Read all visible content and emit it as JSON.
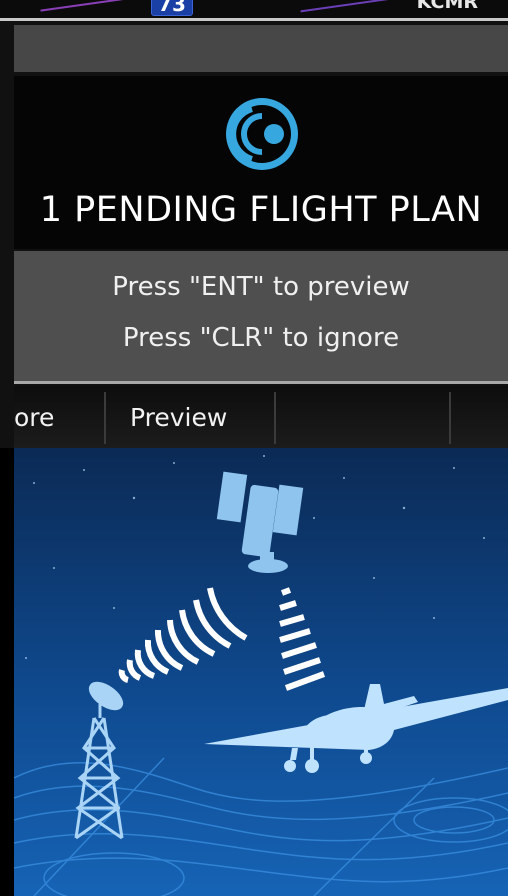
{
  "map_strip": {
    "badge": "73",
    "waypoint": "KCMR"
  },
  "alert": {
    "icon": "connext-signal-icon",
    "title": "1 PENDING FLIGHT PLAN",
    "line1": "Press \"ENT\" to preview",
    "line2": "Press \"CLR\" to ignore"
  },
  "softkeys": [
    {
      "label": "ore"
    },
    {
      "label": "Preview"
    },
    {
      "label": ""
    },
    {
      "label": ""
    }
  ],
  "illustration": {
    "subjects": [
      "satellite-icon",
      "radio-tower-icon",
      "airplane-icon",
      "signal-waves-icon"
    ]
  },
  "colors": {
    "icon_blue": "#37a7e0",
    "panel_grey": "#4f4f4f",
    "sky_top": "#0b2a55",
    "sky_bottom": "#1663b5"
  }
}
